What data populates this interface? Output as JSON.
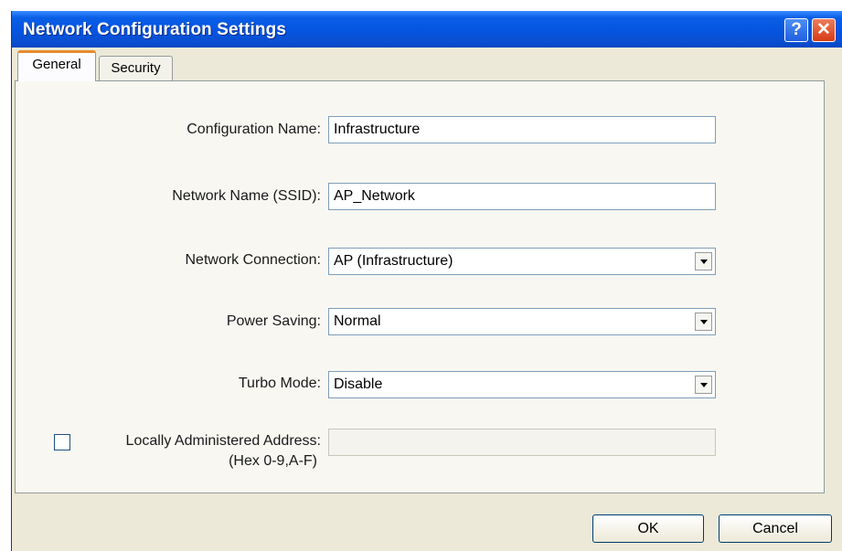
{
  "window": {
    "title": "Network Configuration Settings"
  },
  "titlebar": {
    "help_glyph": "?",
    "close_glyph": "✕"
  },
  "tabs": [
    {
      "label": "General",
      "active": true
    },
    {
      "label": "Security",
      "active": false
    }
  ],
  "fields": {
    "config_name": {
      "label": "Configuration Name:",
      "value": "Infrastructure"
    },
    "ssid": {
      "label": "Network Name (SSID):",
      "value": "AP_Network"
    },
    "connection": {
      "label": "Network Connection:",
      "value": "AP (Infrastructure)"
    },
    "power": {
      "label": "Power Saving:",
      "value": "Normal"
    },
    "turbo": {
      "label": "Turbo Mode:",
      "value": "Disable"
    },
    "laa": {
      "label_line1": "Locally Administered Address:",
      "label_line2": "(Hex 0-9,A-F)",
      "value": "",
      "checked": false
    }
  },
  "buttons": {
    "ok": "OK",
    "cancel": "Cancel"
  },
  "colors": {
    "titlebar": "#0554e0",
    "accent_tab": "#e68b2c",
    "dialog_bg": "#ece9d8"
  }
}
